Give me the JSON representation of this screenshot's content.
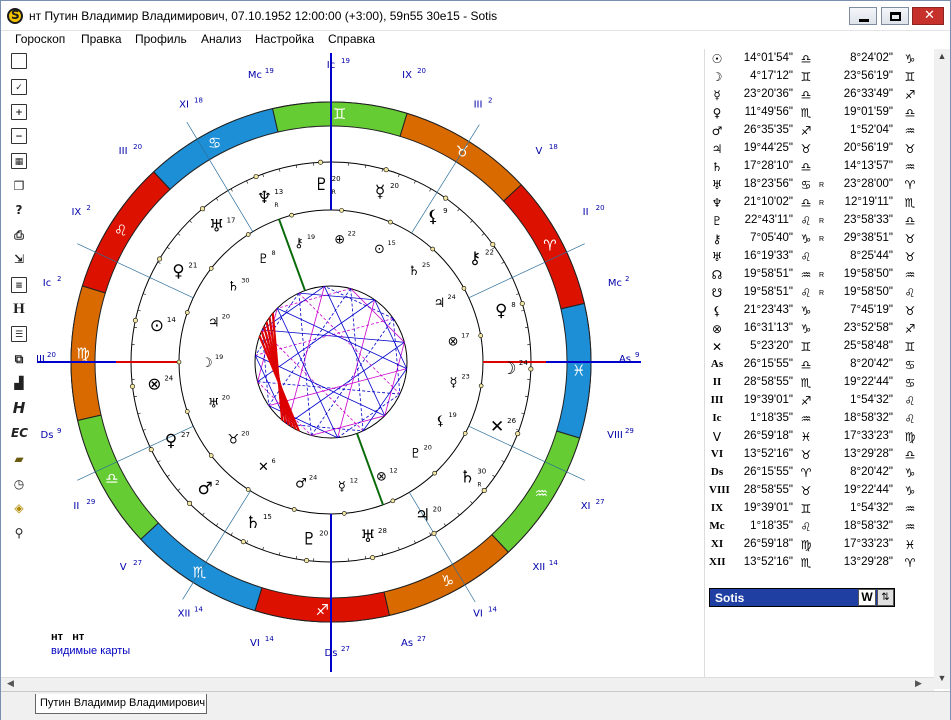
{
  "window": {
    "title": "нт Путин Владимир Владимирович, 07.10.1952 12:00:00 (+3:00), 59n55 30e15 - Sotis"
  },
  "menu": [
    "Гороскоп",
    "Правка",
    "Профиль",
    "Анализ",
    "Настройка",
    "Справка"
  ],
  "toolbar_icons": [
    "new-document-icon",
    "check-document-icon",
    "add-document-icon",
    "remove-document-icon",
    "image-icon",
    "copy-icon",
    "document-query-icon",
    "print-icon",
    "export-icon",
    "text-icon",
    "h-icon",
    "list-icon",
    "pages-icon",
    "bar-chart-icon",
    "italic-h-icon",
    "ec-icon",
    "folder-icon",
    "clock-icon",
    "map-icon",
    "search-icon"
  ],
  "legend": {
    "names": [
      "нт",
      "нт"
    ],
    "caption": "видимые карты"
  },
  "zodiac_ring": {
    "colors": {
      "fire": "#dd1100",
      "earth": "#d96a00",
      "air": "#66cc33",
      "water": "#1d8fd6"
    },
    "signs": [
      "♈",
      "♉",
      "♊",
      "♋",
      "♌",
      "♍",
      "♎",
      "♏",
      "♐",
      "♑",
      "♒",
      "♓"
    ]
  },
  "chart_labels": {
    "house_cusps": [
      {
        "name": "Ic",
        "deg": "19"
      },
      {
        "name": "IX",
        "deg": "20"
      },
      {
        "name": "III",
        "deg": "2"
      },
      {
        "name": "V",
        "deg": "18"
      },
      {
        "name": "II",
        "deg": "20"
      },
      {
        "name": "Mc",
        "deg": "2"
      },
      {
        "name": "As",
        "deg": "9"
      },
      {
        "name": "VIII",
        "deg": "29"
      },
      {
        "name": "XI",
        "deg": "27"
      },
      {
        "name": "XII",
        "deg": "14"
      },
      {
        "name": "VI",
        "deg": "14"
      },
      {
        "name": "As",
        "deg": "27"
      },
      {
        "name": "Ds",
        "deg": "27"
      },
      {
        "name": "VI",
        "deg": "14"
      },
      {
        "name": "XII",
        "deg": "14"
      },
      {
        "name": "V",
        "deg": "27"
      },
      {
        "name": "II",
        "deg": "29"
      },
      {
        "name": "Ds",
        "deg": "9"
      },
      {
        "name": "VIII",
        "deg": "20"
      },
      {
        "name": "Ic",
        "deg": "2"
      },
      {
        "name": "IX",
        "deg": "2"
      },
      {
        "name": "III",
        "deg": "20"
      },
      {
        "name": "XI",
        "deg": "18"
      },
      {
        "name": "Mc",
        "deg": "19"
      }
    ],
    "outer_planets": [
      {
        "glyph": "♆",
        "deg": "13",
        "r": "R"
      },
      {
        "glyph": "♇",
        "deg": "20",
        "r": "R"
      },
      {
        "glyph": "☿",
        "deg": "20"
      },
      {
        "glyph": "⚸",
        "deg": "9"
      },
      {
        "glyph": "⚷",
        "deg": "22"
      },
      {
        "glyph": "♀",
        "deg": "8"
      },
      {
        "glyph": "☽",
        "deg": "24"
      },
      {
        "glyph": "✕",
        "deg": "26"
      },
      {
        "glyph": "♄",
        "deg": "30",
        "r": "R"
      },
      {
        "glyph": "♃",
        "deg": "20"
      },
      {
        "glyph": "♅",
        "deg": "28"
      },
      {
        "glyph": "♇",
        "deg": "20"
      },
      {
        "glyph": "♄",
        "deg": "15"
      },
      {
        "glyph": "♂",
        "deg": "2"
      },
      {
        "glyph": "♀",
        "deg": "27"
      },
      {
        "glyph": "⊗",
        "deg": "24"
      },
      {
        "glyph": "⊙",
        "deg": "14"
      },
      {
        "glyph": "♀",
        "deg": "21"
      },
      {
        "glyph": "♅",
        "deg": "17"
      }
    ],
    "inner_planets": [
      {
        "glyph": "⚷",
        "deg": "19"
      },
      {
        "glyph": "⊕",
        "deg": "22"
      },
      {
        "glyph": "⊙",
        "deg": "15"
      },
      {
        "glyph": "♄",
        "deg": "25"
      },
      {
        "glyph": "♃",
        "deg": "24"
      },
      {
        "glyph": "⊗",
        "deg": "17"
      },
      {
        "glyph": "☿",
        "deg": "23"
      },
      {
        "glyph": "⚸",
        "deg": "19"
      },
      {
        "glyph": "♇",
        "deg": "20"
      },
      {
        "glyph": "⊗",
        "deg": "12"
      },
      {
        "glyph": "☿",
        "deg": "12"
      },
      {
        "glyph": "♂",
        "deg": "24"
      },
      {
        "glyph": "✕",
        "deg": "6"
      },
      {
        "glyph": "♉",
        "deg": "20"
      },
      {
        "glyph": "♅",
        "deg": "20"
      },
      {
        "glyph": "☽",
        "deg": "19"
      },
      {
        "glyph": "♃",
        "deg": "20"
      },
      {
        "glyph": "♄",
        "deg": "30"
      },
      {
        "glyph": "♇",
        "deg": "8"
      }
    ]
  },
  "table": [
    {
      "sym": "☉",
      "deg1": "14°01'54\"",
      "sign1": "♎",
      "r": "",
      "deg2": "8°24'02\"",
      "sign2": "♑"
    },
    {
      "sym": "☽",
      "deg1": "4°17'12\"",
      "sign1": "♊",
      "r": "",
      "deg2": "23°56'19\"",
      "sign2": "♊"
    },
    {
      "sym": "☿",
      "deg1": "23°20'36\"",
      "sign1": "♎",
      "r": "",
      "deg2": "26°33'49\"",
      "sign2": "♐"
    },
    {
      "sym": "♀",
      "deg1": "11°49'56\"",
      "sign1": "♏",
      "r": "",
      "deg2": "19°01'59\"",
      "sign2": "♎"
    },
    {
      "sym": "♂",
      "deg1": "26°35'35\"",
      "sign1": "♐",
      "r": "",
      "deg2": "1°52'04\"",
      "sign2": "♒"
    },
    {
      "sym": "♃",
      "deg1": "19°44'25\"",
      "sign1": "♉",
      "r": "",
      "deg2": "20°56'19\"",
      "sign2": "♉"
    },
    {
      "sym": "♄",
      "deg1": "17°28'10\"",
      "sign1": "♎",
      "r": "",
      "deg2": "14°13'57\"",
      "sign2": "♒"
    },
    {
      "sym": "♅",
      "deg1": "18°23'56\"",
      "sign1": "♋",
      "r": "R",
      "deg2": "23°28'00\"",
      "sign2": "♈"
    },
    {
      "sym": "♆",
      "deg1": "21°10'02\"",
      "sign1": "♎",
      "r": "R",
      "deg2": "12°19'11\"",
      "sign2": "♏"
    },
    {
      "sym": "♇",
      "deg1": "22°43'11\"",
      "sign1": "♌",
      "r": "R",
      "deg2": "23°58'33\"",
      "sign2": "♎"
    },
    {
      "sym": "⚷",
      "deg1": "7°05'40\"",
      "sign1": "♑",
      "r": "R",
      "deg2": "29°38'51\"",
      "sign2": "♉"
    },
    {
      "sym": "♅",
      "deg1": "16°19'33\"",
      "sign1": "♌",
      "r": "",
      "deg2": "8°25'44\"",
      "sign2": "♉"
    },
    {
      "sym": "☊",
      "deg1": "19°58'51\"",
      "sign1": "♒",
      "r": "R",
      "deg2": "19°58'50\"",
      "sign2": "♒"
    },
    {
      "sym": "☋",
      "deg1": "19°58'51\"",
      "sign1": "♌",
      "r": "R",
      "deg2": "19°58'50\"",
      "sign2": "♌"
    },
    {
      "sym": "⚸",
      "deg1": "21°23'43\"",
      "sign1": "♑",
      "r": "",
      "deg2": "7°45'19\"",
      "sign2": "♉"
    },
    {
      "sym": "⊗",
      "deg1": "16°31'13\"",
      "sign1": "♑",
      "r": "",
      "deg2": "23°52'58\"",
      "sign2": "♐"
    },
    {
      "sym": "✕",
      "deg1": "5°23'20\"",
      "sign1": "♊",
      "r": "",
      "deg2": "25°58'48\"",
      "sign2": "♊"
    },
    {
      "sym": "As",
      "deg1": "26°15'55\"",
      "sign1": "♎",
      "r": "",
      "deg2": "8°20'42\"",
      "sign2": "♋"
    },
    {
      "sym": "II",
      "deg1": "28°58'55\"",
      "sign1": "♏",
      "r": "",
      "deg2": "19°22'44\"",
      "sign2": "♋"
    },
    {
      "sym": "III",
      "deg1": "19°39'01\"",
      "sign1": "♐",
      "r": "",
      "deg2": "1°54'32\"",
      "sign2": "♌"
    },
    {
      "sym": "Ic",
      "deg1": "1°18'35\"",
      "sign1": "♒",
      "r": "",
      "deg2": "18°58'32\"",
      "sign2": "♌"
    },
    {
      "sym": "V",
      "deg1": "26°59'18\"",
      "sign1": "♓",
      "r": "",
      "deg2": "17°33'23\"",
      "sign2": "♍"
    },
    {
      "sym": "VI",
      "deg1": "13°52'16\"",
      "sign1": "♉",
      "r": "",
      "deg2": "13°29'28\"",
      "sign2": "♎"
    },
    {
      "sym": "Ds",
      "deg1": "26°15'55\"",
      "sign1": "♈",
      "r": "",
      "deg2": "8°20'42\"",
      "sign2": "♑"
    },
    {
      "sym": "VIII",
      "deg1": "28°58'55\"",
      "sign1": "♉",
      "r": "",
      "deg2": "19°22'44\"",
      "sign2": "♑"
    },
    {
      "sym": "IX",
      "deg1": "19°39'01\"",
      "sign1": "♊",
      "r": "",
      "deg2": "1°54'32\"",
      "sign2": "♒"
    },
    {
      "sym": "Mc",
      "deg1": "1°18'35\"",
      "sign1": "♌",
      "r": "",
      "deg2": "18°58'32\"",
      "sign2": "♒"
    },
    {
      "sym": "XI",
      "deg1": "26°59'18\"",
      "sign1": "♍",
      "r": "",
      "deg2": "17°33'23\"",
      "sign2": "♓"
    },
    {
      "sym": "XII",
      "deg1": "13°52'16\"",
      "sign1": "♏",
      "r": "",
      "deg2": "13°29'28\"",
      "sign2": "♈"
    }
  ],
  "sotis_field": {
    "label": "Sotis",
    "w_button": "W",
    "s_button": "⇅"
  },
  "tabs": [
    "Путин Владимир Владимирович"
  ],
  "scrollbar_arrows": {
    "left": "◀",
    "right": "▶",
    "up": "▲",
    "down": "▼"
  }
}
